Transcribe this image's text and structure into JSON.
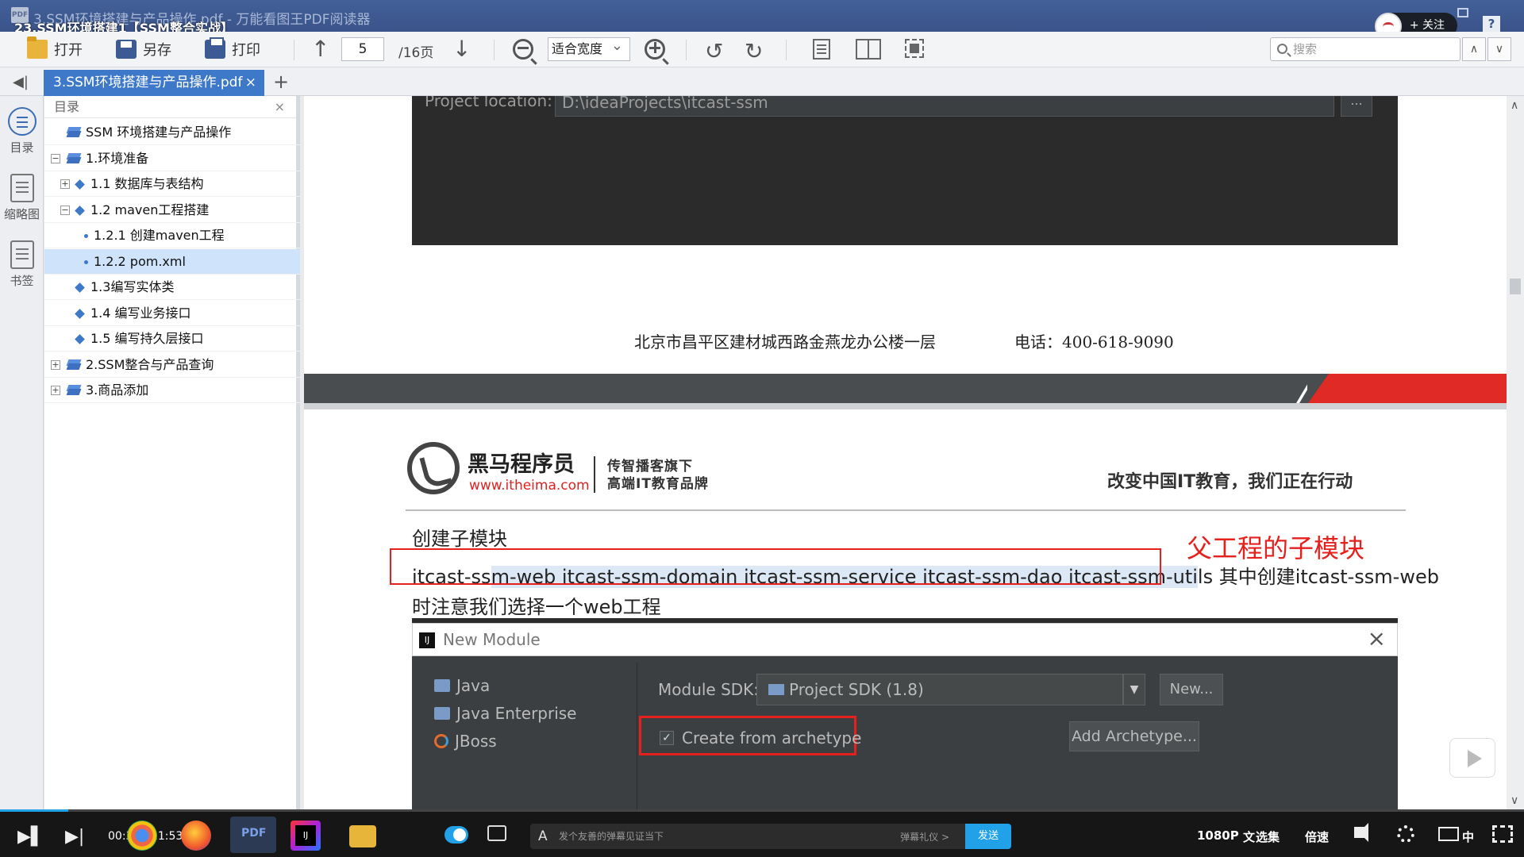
{
  "window": {
    "doc_title": "3.SSM环境搭建与产品操作.pdf - 万能看图王PDF阅读器",
    "video_title": "23.SSM环境搭建1【SSM整合实战】",
    "app_badge": "PDF",
    "follow_label": "+ 关注",
    "help_label": "?"
  },
  "toolbar": {
    "open_label": "打开",
    "save_as_label": "另存",
    "print_label": "打印",
    "current_page": "5",
    "total_pages": "/16页",
    "zoom_mode": "适合宽度",
    "search_placeholder": "搜索"
  },
  "tabs": {
    "active_label": "3.SSM环境搭建与产品操作.pdf",
    "close_glyph": "×",
    "new_glyph": "+"
  },
  "rail": {
    "items": [
      {
        "label": "目录",
        "icon": "toc-icon"
      },
      {
        "label": "缩略图",
        "icon": "thumbnail-icon"
      },
      {
        "label": "书签",
        "icon": "bookmark-icon"
      }
    ]
  },
  "toc": {
    "header": "目录",
    "items": [
      {
        "label": "SSM 环境搭建与产品操作",
        "level": 0,
        "icon": "stack-icon",
        "expander": ""
      },
      {
        "label": "1.环境准备",
        "level": 0,
        "icon": "stack-icon",
        "expander": "−"
      },
      {
        "label": "1.1 数据库与表结构",
        "level": 1,
        "icon": "diamond-icon",
        "expander": "+"
      },
      {
        "label": "1.2 maven工程搭建",
        "level": 1,
        "icon": "diamond-icon",
        "expander": "−"
      },
      {
        "label": "1.2.1 创建maven工程",
        "level": 2,
        "icon": "dot-icon",
        "expander": ""
      },
      {
        "label": "1.2.2 pom.xml",
        "level": 2,
        "icon": "dot-icon",
        "expander": "",
        "selected": true
      },
      {
        "label": "1.3编写实体类",
        "level": 1,
        "icon": "diamond-icon",
        "expander": ""
      },
      {
        "label": "1.4 编写业务接口",
        "level": 1,
        "icon": "diamond-icon",
        "expander": ""
      },
      {
        "label": "1.5 编写持久层接口",
        "level": 1,
        "icon": "diamond-icon",
        "expander": ""
      },
      {
        "label": "2.SSM整合与产品查询",
        "level": 0,
        "icon": "stack-icon",
        "expander": "+"
      },
      {
        "label": "3.商品添加",
        "level": 0,
        "icon": "stack-icon",
        "expander": "+"
      }
    ]
  },
  "document": {
    "project_location_label": "Project location:",
    "project_location_value": "D:\\ideaProjects\\itcast-ssm",
    "project_location_btn": "...",
    "footer_address": "北京市昌平区建材城西路金燕龙办公楼一层",
    "footer_phone": "电话：400-618-9090",
    "logo_name": "黑马程序员",
    "logo_url": "www.itheima.com",
    "logo_tagline1": "传智播客旗下",
    "logo_tagline2": "高端IT教育品牌",
    "slogan": "改变中国IT教育，我们正在行动",
    "section_heading": "创建子模块",
    "para_prefix": "itcast-ss",
    "para_highlight": "m-web itcast-ssm-domain itcast-ssm-service itcast-ssm-dao itcast-ssm-uti",
    "para_suffix": "ls 其中创建itcast-ssm-web",
    "para_line2": "时注意我们选择一个web工程",
    "annotation": "父工程的子模块",
    "dialog": {
      "title": "New Module",
      "idea_badge": "IJ",
      "close_glyph": "×",
      "list": [
        "Java",
        "Java Enterprise",
        "JBoss"
      ],
      "sdk_label": "Module SDK:",
      "sdk_value": "Project SDK (1.8)",
      "sdk_drop": "▼",
      "new_button": "New...",
      "archetype_label": "Create from archetype",
      "archetype_checked": "✓",
      "add_archetype_button": "Add Archetype..."
    }
  },
  "player": {
    "time": "00:32 / 11:53",
    "progress_fraction": 0.045,
    "danmu_placeholder": "发个友善的弹幕见证当下",
    "danmu_etiquette": "弹幕礼仪 >",
    "send_label": "发送",
    "quality": "1080P",
    "caption_label": "文",
    "episodes_label": "选集",
    "speed_label": "倍速",
    "subtitle_lang": "中",
    "accent_color": "#21a1e7"
  }
}
